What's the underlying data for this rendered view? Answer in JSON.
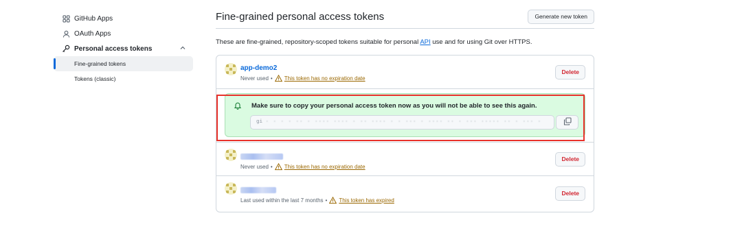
{
  "sidebar": {
    "items": [
      {
        "label": "GitHub Apps",
        "icon": "apps-icon"
      },
      {
        "label": "OAuth Apps",
        "icon": "person-icon"
      },
      {
        "label": "Personal access tokens",
        "icon": "key-icon"
      }
    ],
    "sub_items": [
      {
        "label": "Fine-grained tokens",
        "active": true
      },
      {
        "label": "Tokens (classic)",
        "active": false
      }
    ]
  },
  "main": {
    "title": "Fine-grained personal access tokens",
    "generate_label": "Generate new token",
    "description_before": "These are fine-grained, repository-scoped tokens suitable for personal ",
    "description_link": "API",
    "description_after": " use and for using Git over HTTPS.",
    "tokens": [
      {
        "name": "app-demo2",
        "status": "Never used",
        "separator": "•",
        "warning": "This token has no expiration date",
        "delete_label": "Delete"
      },
      {
        "name": "",
        "status": "Never used",
        "separator": "•",
        "warning": "This token has no expiration date",
        "delete_label": "Delete"
      },
      {
        "name": "",
        "status": "Last used within the last 7 months",
        "separator": "•",
        "warning": "This token has expired",
        "delete_label": "Delete"
      }
    ],
    "flash": {
      "message": "Make sure to copy your personal access token now as you will not be able to see this again.",
      "token_prefix": "gi",
      "token_suffix": "ivHj"
    }
  },
  "colors": {
    "accent": "#0969da",
    "danger": "#d1242f",
    "warning": "#9a6700",
    "flash_bg": "#dafbe1",
    "highlight": "#e8312a"
  }
}
